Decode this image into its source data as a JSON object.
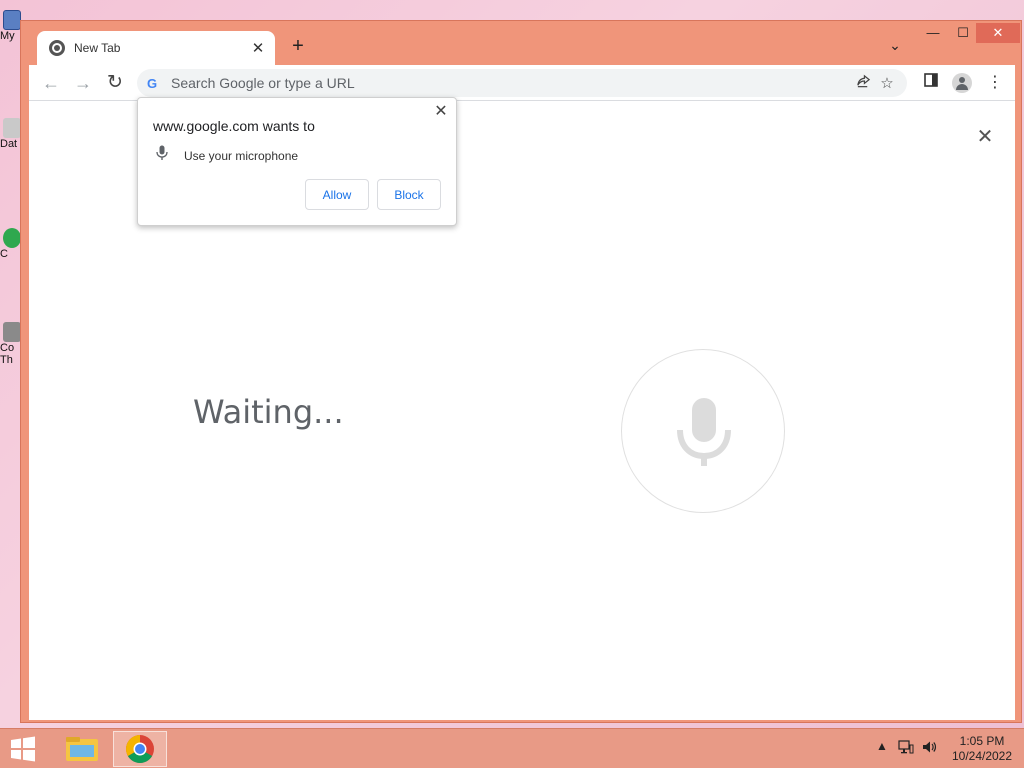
{
  "desktop": {
    "icons": [
      {
        "label": "My"
      },
      {
        "label": "Dat"
      },
      {
        "label": "C"
      },
      {
        "label": "Co"
      },
      {
        "label": "Th"
      }
    ]
  },
  "browser": {
    "tab": {
      "title": "New Tab",
      "close": "✕"
    },
    "new_tab": "+",
    "tab_search": "⌄",
    "window_controls": {
      "minimize": "—",
      "maximize": "☐",
      "close": "✕"
    },
    "nav": {
      "back": "←",
      "forward": "→",
      "reload": "↻"
    },
    "omnibox": {
      "placeholder": "Search Google or type a URL",
      "value": "",
      "engine_icon": "G"
    },
    "content": {
      "close": "✕",
      "status": "Waiting..."
    }
  },
  "permission_popup": {
    "title": "www.google.com wants to",
    "permission": "Use your microphone",
    "allow": "Allow",
    "block": "Block",
    "close": "✕"
  },
  "taskbar": {
    "time": "1:05 PM",
    "date": "10/24/2022",
    "tray_up": "▲"
  },
  "colors": {
    "window_frame": "#f0957a",
    "taskbar": "#e89a86",
    "accent_blue": "#1a73e8",
    "google_blue": "#4285f4"
  }
}
